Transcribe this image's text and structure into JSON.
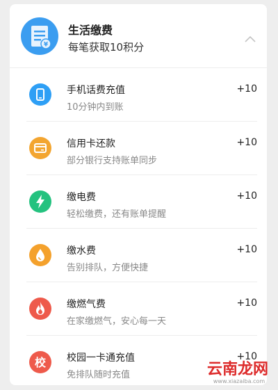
{
  "section": {
    "title": "生活缴费",
    "subtitle": "每笔获取10积分",
    "icon": "bill-document-icon",
    "collapse_icon": "chevron-up-icon"
  },
  "items": [
    {
      "title": "手机话费充值",
      "desc": "10分钟内到账",
      "points": "+10",
      "icon": "phone-icon",
      "color": "#2e9ff5"
    },
    {
      "title": "信用卡还款",
      "desc": "部分银行支持账单同步",
      "points": "+10",
      "icon": "credit-card-icon",
      "color": "#f3a530"
    },
    {
      "title": "缴电费",
      "desc": "轻松缴费，还有账单提醒",
      "points": "+10",
      "icon": "lightning-icon",
      "color": "#24c27f"
    },
    {
      "title": "缴水费",
      "desc": "告别排队，方便快捷",
      "points": "+10",
      "icon": "water-drop-icon",
      "color": "#f4a12c"
    },
    {
      "title": "缴燃气费",
      "desc": "在家缴燃气，安心每一天",
      "points": "+10",
      "icon": "flame-icon",
      "color": "#ee5a4b"
    },
    {
      "title": "校园一卡通充值",
      "desc": "免排队随时充值",
      "points": "+10",
      "icon": "campus-card-icon",
      "color": "#ee5a4b",
      "glyph": "校"
    }
  ],
  "watermark": {
    "logo": "云南龙网",
    "url": "www.xiazaiba.com"
  }
}
